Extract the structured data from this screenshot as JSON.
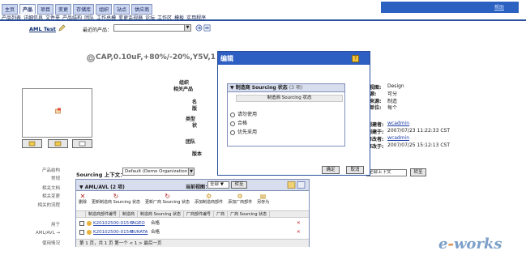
{
  "header": {
    "tabs": [
      "主页",
      "产品",
      "项目",
      "变更",
      "存储库",
      "组织",
      "站点",
      "供应商"
    ],
    "active_tab": 1,
    "submenu": [
      "产品列表",
      "详细信息",
      "文件夹",
      "产品结构",
      "团队",
      "工作总模",
      "变更监视器",
      "论坛",
      "工作区",
      "模板",
      "实用程序"
    ],
    "help_link": "帮助"
  },
  "filter": {
    "aml_title": "AML Test",
    "recent_label": "最近的产品：",
    "recent_value": ""
  },
  "part": {
    "name": "CAP,0.10uF,+80%/-20%,Y5V,1"
  },
  "details_labels": {
    "l1": "组织",
    "l2": "相关产品",
    "l3": "名",
    "l4": "版",
    "l5": "类型",
    "l6": "状",
    "l7": "团队",
    "l8": "版本"
  },
  "right_details": [
    {
      "label": "视图:",
      "value": "Design"
    },
    {
      "label": "源:",
      "value": "可分"
    },
    {
      "label": "来源:",
      "value": "制造"
    },
    {
      "label": "单位:",
      "value": "每个"
    }
  ],
  "audit": [
    {
      "label": "创建者:",
      "value": "wcadmin",
      "link": true
    },
    {
      "label": "创建于:",
      "value": "2007/07/23 11:22:33 CST",
      "link": false
    },
    {
      "label": "修改者:",
      "value": "wcadmin",
      "link": true
    },
    {
      "label": "修改于:",
      "value": "2007/07/25 15:12:13 CST",
      "link": false
    }
  ],
  "left_nav": [
    "产品结构",
    "常规",
    "相关文档",
    "相关变更",
    "相关的流程",
    "用于",
    "AML/AVL →",
    "使用情况"
  ],
  "context": {
    "label": "Sourcing 上下文：",
    "value": "Default (Demo Organization)",
    "right_value": "全部上下文",
    "go_label": "转至"
  },
  "aml_panel": {
    "title": "AML/AVL (2 项)",
    "view_label": "当前视图：",
    "view_value": "全部",
    "go_label": "转至",
    "actions": [
      "删除",
      "更新制造商 Sourcing 状态",
      "更新厂商 Sourcing 状态",
      "添加制造商部件",
      "添加厂商部件",
      "另存为"
    ],
    "columns": [
      "制造商部件编号",
      "制造商",
      "制造商 Sourcing 状态",
      "厂商部件编号",
      "厂商",
      "厂商 Sourcing 状态"
    ],
    "rows": [
      {
        "number": "K20102500-015-0",
        "mfr": "YAGEO",
        "status": "合格"
      },
      {
        "number": "K20102500-015-0",
        "mfr": "MURATA",
        "status": "合格"
      }
    ],
    "pager": "第 1 页，共 1 页      第一个   <   1   >   最后一页"
  },
  "modal": {
    "title": "编辑",
    "section_title": "制造商 Sourcing 状态",
    "section_count": "(3 项)",
    "column": "制造商 Sourcing 状态",
    "options": [
      "请勿使用",
      "合格",
      "优先采用"
    ],
    "selected": null,
    "ok_label": "确定",
    "cancel_label": "取消"
  },
  "watermark": {
    "prefix": "e",
    "dash": "-",
    "suffix": "works"
  }
}
